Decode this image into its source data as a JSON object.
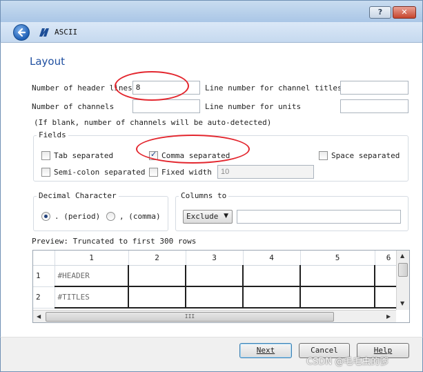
{
  "window": {
    "help_label": "?",
    "close_label": "✕",
    "title": "ASCII",
    "icons": {
      "back": "back-arrow-icon",
      "app": "app-logo-icon"
    }
  },
  "page_title": "Layout",
  "fields": {
    "header_lines_label": "Number of header lines",
    "header_lines_value": "8",
    "channel_titles_label": "Line number for channel titles",
    "channel_titles_value": "",
    "num_channels_label": "Number of channels",
    "num_channels_value": "",
    "units_label": "Line number for units",
    "units_value": "",
    "hint": "(If blank, number of channels will be auto-detected)"
  },
  "separators": {
    "title": "Fields",
    "tab": {
      "label": "Tab separated",
      "checked": false
    },
    "comma": {
      "label": "Comma separated",
      "checked": true
    },
    "space": {
      "label": "Space separated",
      "checked": false
    },
    "semicolon": {
      "label": "Semi-colon separated",
      "checked": false
    },
    "fixed": {
      "label": "Fixed width",
      "checked": false,
      "value": "10"
    }
  },
  "decimal": {
    "title": "Decimal Character",
    "period_label": ". (period)",
    "comma_label": ", (comma)",
    "selected": "period"
  },
  "columns": {
    "title": "Columns to",
    "mode": "Exclude",
    "value": ""
  },
  "preview": {
    "label": "Preview: Truncated to first 300 rows",
    "columns": [
      "1",
      "2",
      "3",
      "4",
      "5",
      "6"
    ],
    "rows": [
      {
        "num": "1",
        "cells": [
          "#HEADER",
          "",
          "",
          "",
          "",
          ""
        ]
      },
      {
        "num": "2",
        "cells": [
          "#TITLES",
          "",
          "",
          "",
          "",
          ""
        ]
      }
    ],
    "hscroll_grip": "III"
  },
  "buttons": {
    "next": "Next",
    "cancel": "Cancel",
    "help": "Help"
  },
  "watermark": "CSDN @毛毛虫的爹",
  "colors": {
    "accent": "#1f4fa0",
    "annotation": "#e3262e",
    "titlebar": "#aac6e6"
  }
}
